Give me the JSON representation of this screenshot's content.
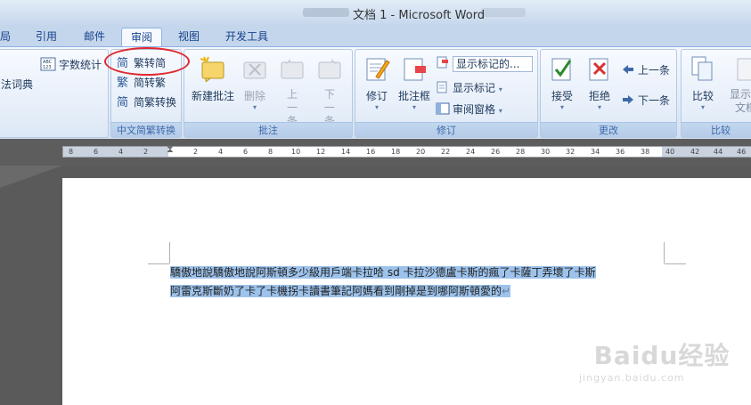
{
  "window": {
    "title": "文档 1 - Microsoft Word"
  },
  "tabs": [
    {
      "label": "局"
    },
    {
      "label": "引用"
    },
    {
      "label": "邮件"
    },
    {
      "label": "审阅",
      "active": true
    },
    {
      "label": "视图"
    },
    {
      "label": "开发工具"
    }
  ],
  "ribbon": {
    "proofing": {
      "word_count": "字数统计",
      "dictionary": "法词典"
    },
    "chinese": {
      "label": "中文简繁转换",
      "to_simplified": "繁转简",
      "to_traditional": "简转繁",
      "convert": "简繁转换"
    },
    "comments": {
      "label": "批注",
      "new_comment": "新建批注",
      "delete": "删除",
      "prev": "上一条",
      "next": "下一条"
    },
    "tracking": {
      "label": "修订",
      "track_changes": "修订",
      "balloons": "批注框",
      "display_select": "显示标记的...",
      "show_markup": "显示标记",
      "reviewing_pane": "审阅窗格"
    },
    "changes": {
      "label": "更改",
      "accept": "接受",
      "reject": "拒绝",
      "previous": "上一条",
      "next": "下一条"
    },
    "compare": {
      "label": "比较",
      "compare": "比较",
      "show_source": "显示源文档"
    }
  },
  "ruler": {
    "left_ticks": [
      "8",
      "6",
      "4",
      "2"
    ],
    "right_ticks": [
      "2",
      "4",
      "6",
      "8",
      "10",
      "12",
      "14",
      "16",
      "18",
      "20",
      "22",
      "24",
      "26",
      "28",
      "30",
      "32",
      "34",
      "36",
      "38",
      "40",
      "42",
      "44",
      "46"
    ]
  },
  "document": {
    "line1": "驕傲地說驕傲地說阿斯頓多少級用戶端卡拉哈 sd 卡拉沙德盧卡斯的瘋了卡薩丁弄壞了卡斯",
    "line2": "阿雷克斯斷奶了卡了卡機拐卡讀書筆記阿媽看到剛掉是到哪阿斯頓愛的",
    "para_mark": "↵"
  },
  "watermark": {
    "brand": "Baidu经验",
    "url": "jingyan.baidu.com"
  },
  "colors": {
    "annotation": "#e0282e",
    "highlight": "#9dc3ec",
    "ribbon_label": "#3e6aaa"
  }
}
